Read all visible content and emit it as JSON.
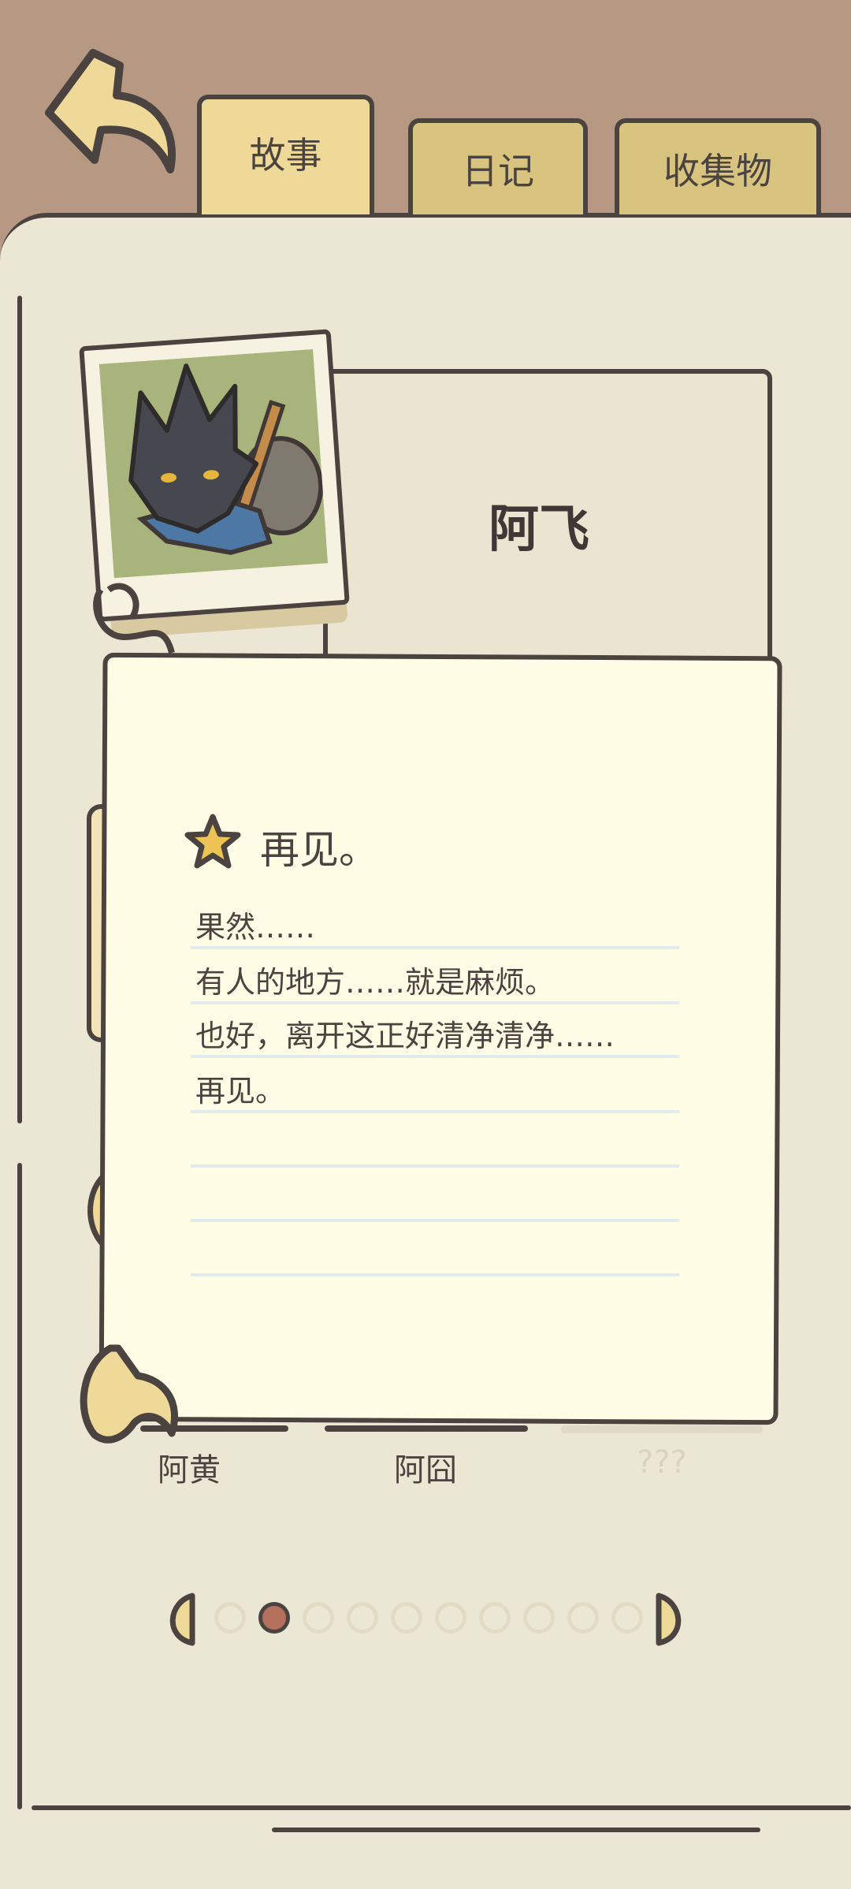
{
  "tabs": {
    "story": "故事",
    "diary": "日记",
    "collection": "收集物"
  },
  "character": {
    "name": "阿飞"
  },
  "note": {
    "title": "再见。",
    "lines": [
      "果然……",
      "有人的地方……就是麻烦。",
      "也好，离开这正好清净清净……",
      "再见。"
    ]
  },
  "characters_list": [
    {
      "label": "阿黄"
    },
    {
      "label": "阿囧"
    },
    {
      "label": "???"
    }
  ],
  "pagination": {
    "total_pages": 10,
    "current_page": 2
  },
  "colors": {
    "background": "#b69883",
    "page": "#ebe7d5",
    "note": "#fffde6",
    "tab": "#e8d59a",
    "outline": "#4a4340",
    "active_dot": "#b5715d"
  }
}
